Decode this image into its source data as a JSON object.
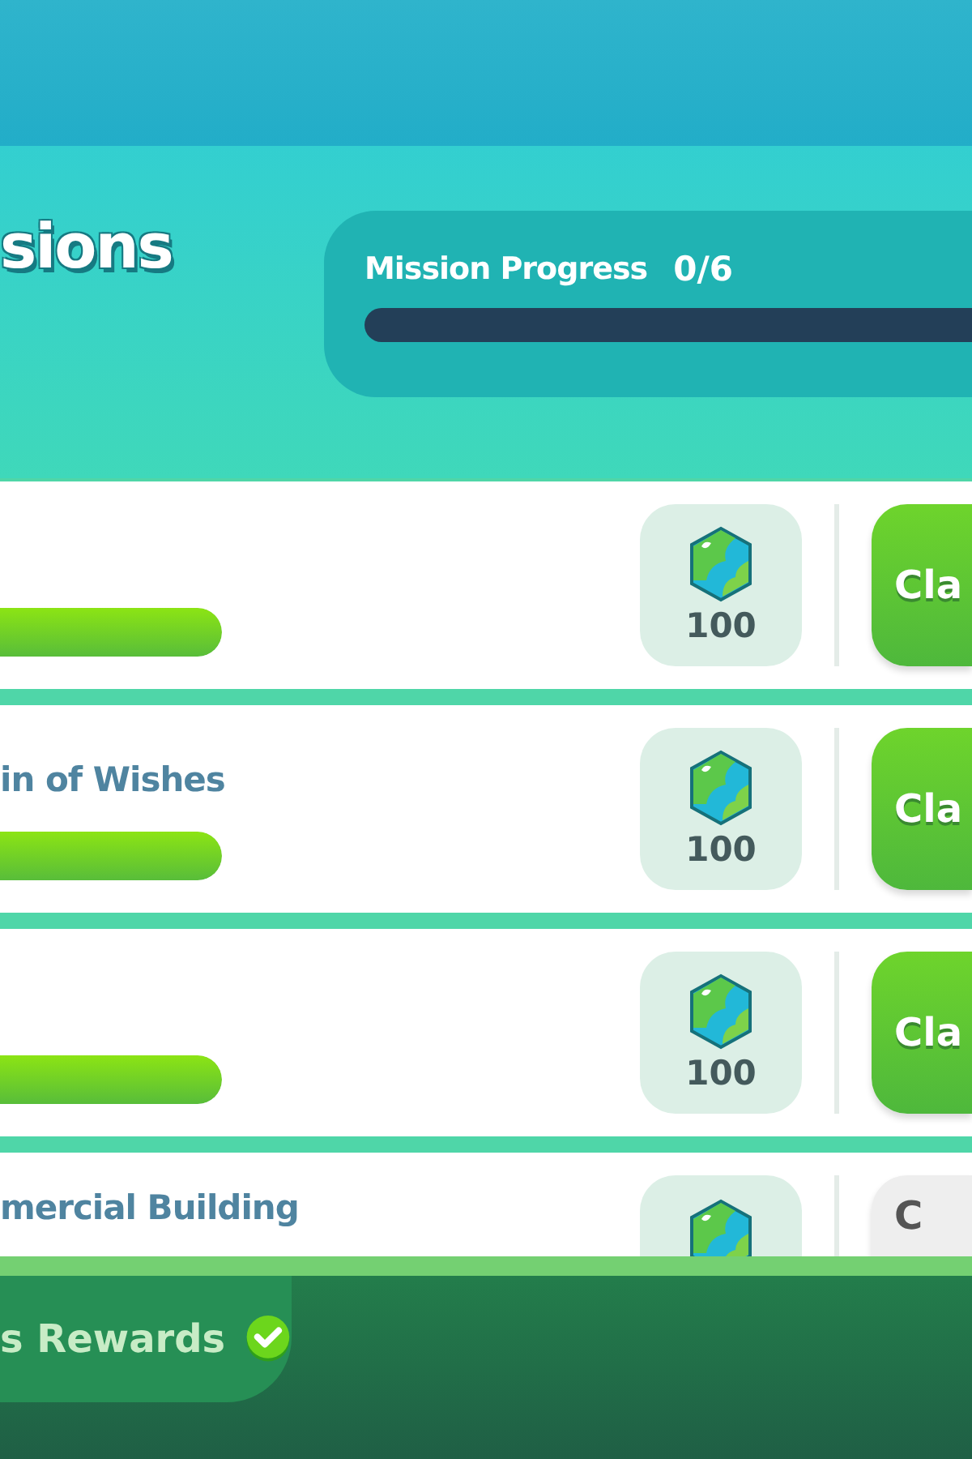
{
  "header": {
    "title": "sions",
    "progress": {
      "label": "Mission Progress",
      "count": "0/6",
      "level": 0
    }
  },
  "missions": [
    {
      "level": 1,
      "reward": "100",
      "button": "Cla",
      "claimable": true
    },
    {
      "title": "in of Wishes",
      "level": 1,
      "reward": "100",
      "button": "Cla",
      "claimable": true
    },
    {
      "level": 1,
      "reward": "100",
      "button": "Cla",
      "claimable": true
    },
    {
      "title": "mercial Building",
      "button": "C",
      "claimable": false
    }
  ],
  "footer": {
    "label": "s Rewards",
    "done": true
  }
}
